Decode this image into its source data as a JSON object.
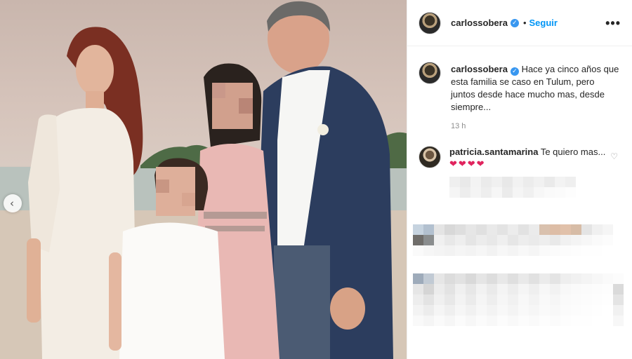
{
  "post": {
    "author": "carlossobera",
    "follow_label": "Seguir",
    "separator": "•",
    "more_icon": "more-horizontal-icon",
    "caption": "Hace ya cinco años que esta familia se caso en Tulum, pero juntos desde hace mucho mas, desde siempre...",
    "time_ago": "13 h"
  },
  "comments": [
    {
      "author": "patricia.santamarina",
      "text": "Te quiero mas...",
      "emoji": "❤❤❤❤"
    }
  ],
  "carousel": {
    "prev_icon": "chevron-left-icon",
    "prev_glyph": "‹"
  },
  "colors": {
    "accent": "#0095f6",
    "verified": "#3897f0",
    "heart": "#e0245e",
    "muted": "#8e8e8e"
  }
}
